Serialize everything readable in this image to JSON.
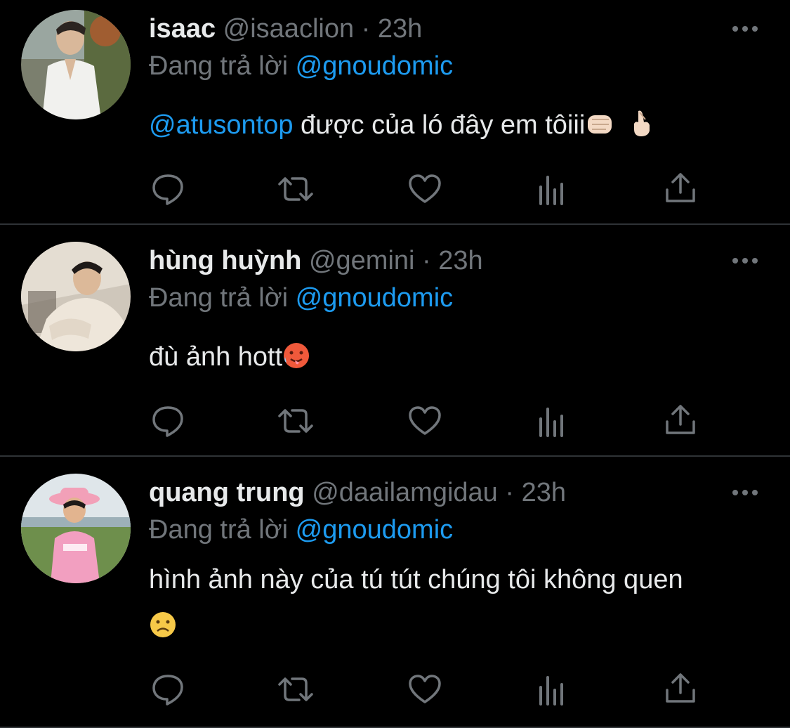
{
  "tweets": [
    {
      "name": "isaac",
      "handle": "@isaaclion",
      "dot": "·",
      "time": "23h",
      "replying_prefix": "Đang trả lời",
      "replying_to": "@gnoudomic",
      "mention": "@atusontop",
      "text": " được của ló đây em tôiii"
    },
    {
      "name": "hùng huỳnh",
      "handle": "@gemini",
      "dot": "·",
      "time": "23h",
      "replying_prefix": "Đang trả lời",
      "replying_to": "@gnoudomic",
      "text": "đù ảnh hott"
    },
    {
      "name": "quang trung",
      "handle": "@daailamgidau",
      "dot": "·",
      "time": "23h",
      "replying_prefix": "Đang trả lời",
      "replying_to": "@gnoudomic",
      "text": "hình ảnh này của tú tút chúng tôi không quen"
    }
  ],
  "icons": {
    "more": "more-horizontal-icon",
    "reply": "reply-bubble-icon",
    "retweet": "retweet-icon",
    "like": "heart-icon",
    "views": "bar-chart-icon",
    "share": "share-upload-icon"
  },
  "colors": {
    "background": "#000000",
    "text": "#e7e9ea",
    "secondary": "#71767b",
    "link": "#1d9bf0",
    "divider": "#2f3336"
  }
}
